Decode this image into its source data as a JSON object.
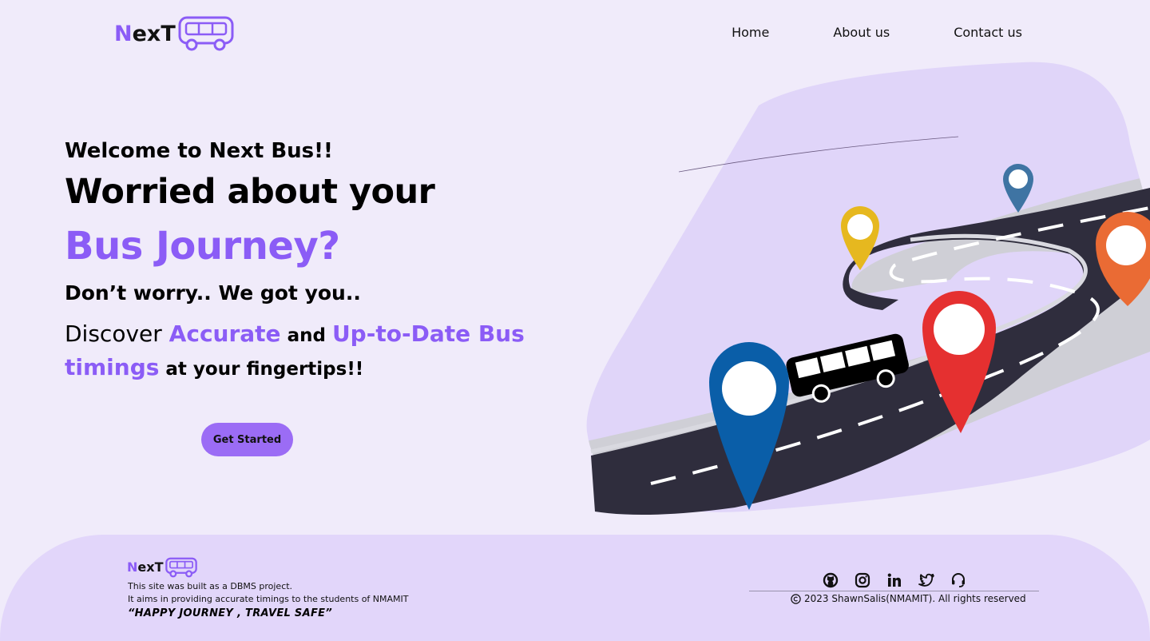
{
  "brand": {
    "logo_n": "N",
    "logo_rest": "exT"
  },
  "nav": {
    "items": [
      "Home",
      "About us",
      "Contact us"
    ]
  },
  "hero": {
    "welcome": "Welcome to Next Bus!!",
    "headline1": "Worried about your",
    "headline2": "Bus Journey?",
    "reassure": "Don’t worry.. We got you..",
    "discover_prefix": "Discover ",
    "discover_accent1": "Accurate",
    "discover_mid": " and ",
    "discover_accent2": "Up-to-Date Bus timings",
    "discover_suffix": " at your fingertips!!",
    "cta": "Get Started"
  },
  "footer": {
    "line1": "This site was built as a DBMS project.",
    "line2": "It aims in providing accurate timings to the students of NMAMIT",
    "quote": "“HAPPY JOURNEY , TRAVEL SAFE”",
    "copyright": "2023 ShawnSalis(NMAMIT). All rights reserved",
    "social_icons": [
      "github-icon",
      "instagram-icon",
      "linkedin-icon",
      "twitter-icon",
      "headset-icon"
    ]
  },
  "colors": {
    "accent": "#8b5cf6",
    "background": "#f0ebfa",
    "footer": "#e2d6fa",
    "blob": "#e0d5f9",
    "road": "#2f2d3d"
  }
}
